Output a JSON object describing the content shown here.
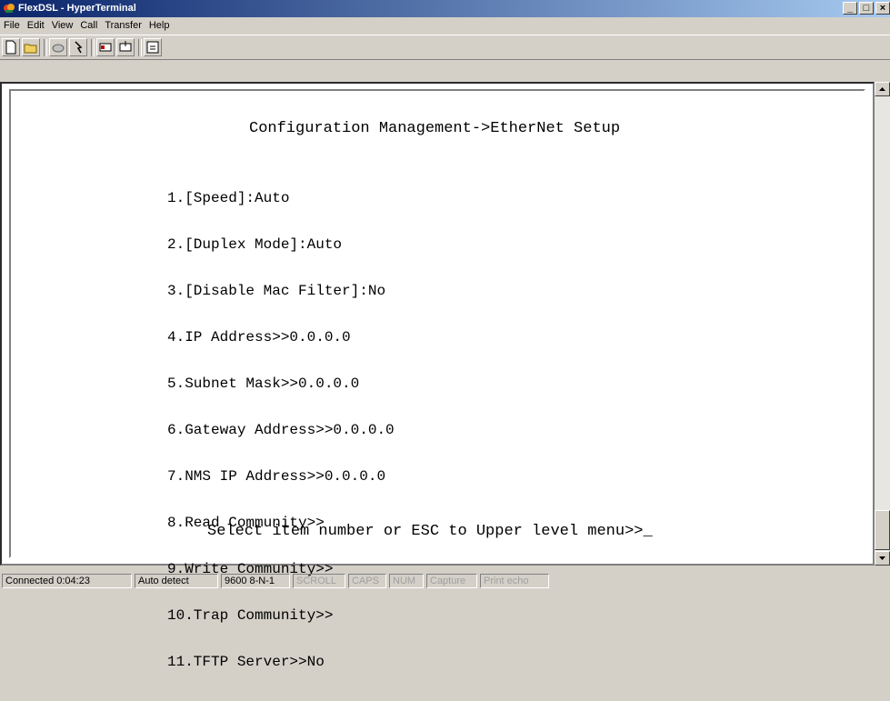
{
  "window": {
    "title": "FlexDSL - HyperTerminal"
  },
  "menu": [
    {
      "label": "File"
    },
    {
      "label": "Edit"
    },
    {
      "label": "View"
    },
    {
      "label": "Call"
    },
    {
      "label": "Transfer"
    },
    {
      "label": "Help"
    }
  ],
  "toolbar": {
    "icons": [
      "new-connection-icon",
      "open-icon",
      "disconnect-phone-icon",
      "connect-icon",
      "send-file-icon",
      "receive-file-icon",
      "properties-icon"
    ]
  },
  "terminal": {
    "title": "Configuration Management->EtherNet Setup",
    "items": [
      "1.[Speed]:Auto",
      "2.[Duplex Mode]:Auto",
      "3.[Disable Mac Filter]:No",
      "4.IP Address>>0.0.0.0",
      "5.Subnet Mask>>0.0.0.0",
      "6.Gateway Address>>0.0.0.0",
      "7.NMS IP Address>>0.0.0.0",
      "8.Read Community>>",
      "9.Write Community>>",
      "10.Trap Community>>",
      "11.TFTP Server>>No"
    ],
    "prompt": "Select item number or ESC to Upper level menu>>",
    "cursor": "_"
  },
  "status": {
    "connected": "Connected 0:04:23",
    "detect": "Auto detect",
    "settings": "9600 8-N-1",
    "scroll": "SCROLL",
    "caps": "CAPS",
    "num": "NUM",
    "capture": "Capture",
    "print_echo": "Print echo"
  }
}
